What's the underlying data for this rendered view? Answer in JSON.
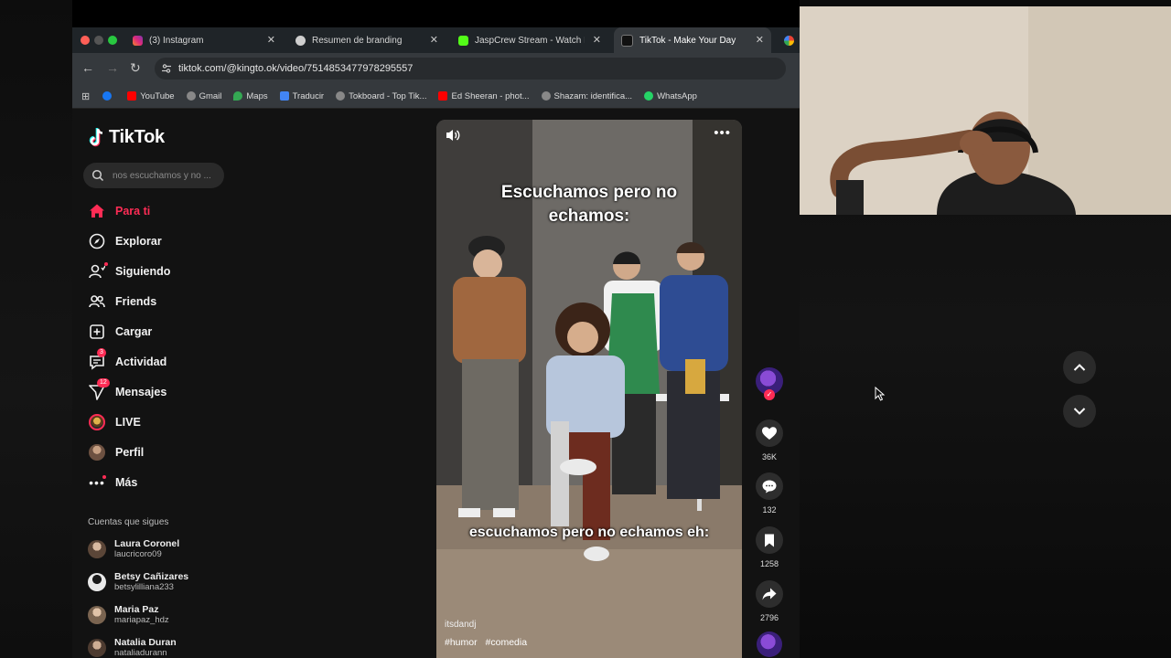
{
  "browser": {
    "tabs": [
      {
        "label": "(3) Instagram",
        "icon": "instagram-icon",
        "color": "#e1306c",
        "active": false
      },
      {
        "label": "Resumen de branding",
        "icon": "chatgpt-icon",
        "color": "#cfcfcf",
        "active": false
      },
      {
        "label": "JaspCrew Stream - Watch Liv",
        "icon": "kick-icon",
        "color": "#53fc18",
        "active": false
      },
      {
        "label": "TikTok - Make Your Day",
        "icon": "tiktok-icon",
        "color": "#ffffff",
        "active": true
      }
    ],
    "url": "tiktok.com/@kingto.ok/video/7514853477978295557",
    "bookmarks": [
      {
        "label": "",
        "icon": "facebook-icon",
        "color": "#1877f2"
      },
      {
        "label": "YouTube",
        "icon": "youtube-icon",
        "color": "#ff0000"
      },
      {
        "label": "Gmail",
        "icon": "globe-icon",
        "color": "#bbbbbb"
      },
      {
        "label": "Maps",
        "icon": "maps-icon",
        "color": "#34a853"
      },
      {
        "label": "Traducir",
        "icon": "translate-icon",
        "color": "#4285f4"
      },
      {
        "label": "Tokboard - Top Tik...",
        "icon": "globe-icon",
        "color": "#bbbbbb"
      },
      {
        "label": "Ed Sheeran - phot...",
        "icon": "youtube-icon",
        "color": "#ff0000"
      },
      {
        "label": "Shazam: identifica...",
        "icon": "globe-icon",
        "color": "#bbbbbb"
      },
      {
        "label": "WhatsApp",
        "icon": "whatsapp-icon",
        "color": "#25d366"
      }
    ]
  },
  "tiktok": {
    "logo": "TikTok",
    "search_placeholder": "nos escuchamos y no ...",
    "accent": "#fe2c55",
    "nav": [
      {
        "label": "Para ti",
        "icon": "home-icon",
        "active": true
      },
      {
        "label": "Explorar",
        "icon": "compass-icon"
      },
      {
        "label": "Siguiendo",
        "icon": "following-icon",
        "dot": true
      },
      {
        "label": "Friends",
        "icon": "friends-icon"
      },
      {
        "label": "Cargar",
        "icon": "upload-icon"
      },
      {
        "label": "Actividad",
        "icon": "activity-icon",
        "badge": "3"
      },
      {
        "label": "Mensajes",
        "icon": "messages-icon",
        "badge": "12"
      },
      {
        "label": "LIVE",
        "icon": "live-icon"
      },
      {
        "label": "Perfil",
        "icon": "profile-avatar"
      },
      {
        "label": "Más",
        "icon": "more-icon",
        "dot": true
      }
    ],
    "following_heading": "Cuentas que sigues",
    "following": [
      {
        "name": "Laura Coronel",
        "handle": "laucricoro09"
      },
      {
        "name": "Betsy Cañizares",
        "handle": "betsylilliana233"
      },
      {
        "name": "Maria Paz",
        "handle": "mariapaz_hdz"
      },
      {
        "name": "Natalia Duran",
        "handle": "nataliadurann"
      }
    ],
    "video": {
      "caption_top": "Escuchamos pero no echamos:",
      "caption_bottom": "escuchamos pero no echamos eh:",
      "username": "itsdandj",
      "tags": [
        "#humor",
        "#comedia"
      ]
    },
    "actions": {
      "likes": "36K",
      "comments": "132",
      "saves": "1258",
      "shares": "2796"
    }
  }
}
